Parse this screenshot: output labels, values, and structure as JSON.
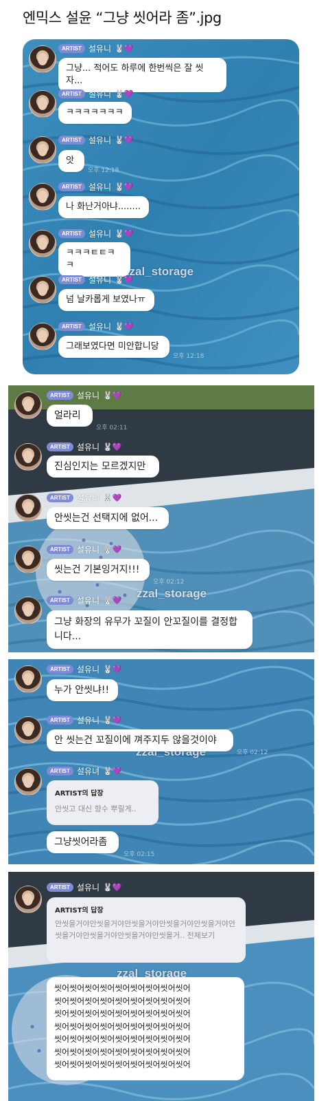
{
  "title": "엔믹스 설윤 “그냥 씻어라 좀”.jpg",
  "watermark": "zzal_storage",
  "colors": {
    "water": "#3b86b4",
    "bubble": "#ffffff",
    "badge": "#7f8bd6"
  },
  "panel1": {
    "messages": [
      {
        "badge": "ARTIST",
        "name": "설유니",
        "text": "그냥... 적어도 하루에 한번씩은 잘 씻자..."
      },
      {
        "badge": "ARTIST",
        "name": "설유니",
        "text": "ㅋㅋㅋㅋㅋㅋㅋ"
      },
      {
        "badge": "ARTIST",
        "name": "설유니",
        "text": "앗",
        "time": "오후 12:18"
      },
      {
        "badge": "ARTIST",
        "name": "설유니",
        "text": "나 화난거아냐........"
      },
      {
        "badge": "ARTIST",
        "name": "설유니",
        "text": "ㅋㅋㅋㅌㅌㅋㅋ"
      },
      {
        "badge": "ARTIST",
        "name": "설유니",
        "text": "넘 날카롭게 보였나ㅠ"
      },
      {
        "badge": "ARTIST",
        "name": "설유니",
        "text": "그래보였다면 미안합니당",
        "time": "오후 12:18"
      }
    ]
  },
  "panel2": {
    "messages": [
      {
        "badge": "ARTIST",
        "name": "설유니",
        "text": "얼라리",
        "time": "오후 02:11"
      },
      {
        "badge": "ARTIST",
        "name": "설유니",
        "text": "진심인지는 모르겠지만"
      },
      {
        "badge": "ARTIST",
        "name": "설유니",
        "text": "안씻는건 선택지에 없어..."
      },
      {
        "badge": "ARTIST",
        "name": "설유니",
        "text": "씻는건 기본잉거지!!!",
        "time": "오후 02:12"
      },
      {
        "badge": "ARTIST",
        "name": "설유니",
        "text": "그냥 화장의 유무가 꼬질이 안꼬질이를 결정합니다..."
      }
    ]
  },
  "panel3": {
    "messages": [
      {
        "badge": "ARTIST",
        "name": "설유니",
        "text": "누가 안씻냐!!"
      },
      {
        "badge": "ARTIST",
        "name": "설유니",
        "text": "안 씻는건 꼬질이에 껴주지두 않을것이야",
        "time": "오후 02:12"
      },
      {
        "badge": "ARTIST",
        "name": "설유녀",
        "reply_head": "ARTIST의 답장",
        "reply_text": "안씻고 대신 향수 뿌릴게..",
        "text": "그냥씻어라좀",
        "time": "오후 02:15"
      }
    ]
  },
  "panel4": {
    "badge": "ARTIST",
    "name": "설유니",
    "reply_head": "ARTIST의 답장",
    "reply_text": "안씻을거야안씻을거야안씻을거야안씻을거야안씻을거야안씻을거야안씻을거야안씻을거야안씻을거.. 전체보기",
    "lines": [
      "씻어씻어씻어씻어씻어씻어씻어씻어씻어",
      "씻어씻어씻어씻어씻어씻어씻어씻어씻어",
      "씻어씻어씻어씻어씻어씻어씻어씻어씻어",
      "씻어씻어씻어씻어씻어씻어씻어씻어씻어",
      "씻어씻어씻어씻어씻어씻어씻어씻어씻어",
      "씻어씻어씻어씻어씻어씻어씻어씻어씻어",
      "씻어씻어씻어씻어씻어씻어씻어씻어씻어"
    ]
  }
}
